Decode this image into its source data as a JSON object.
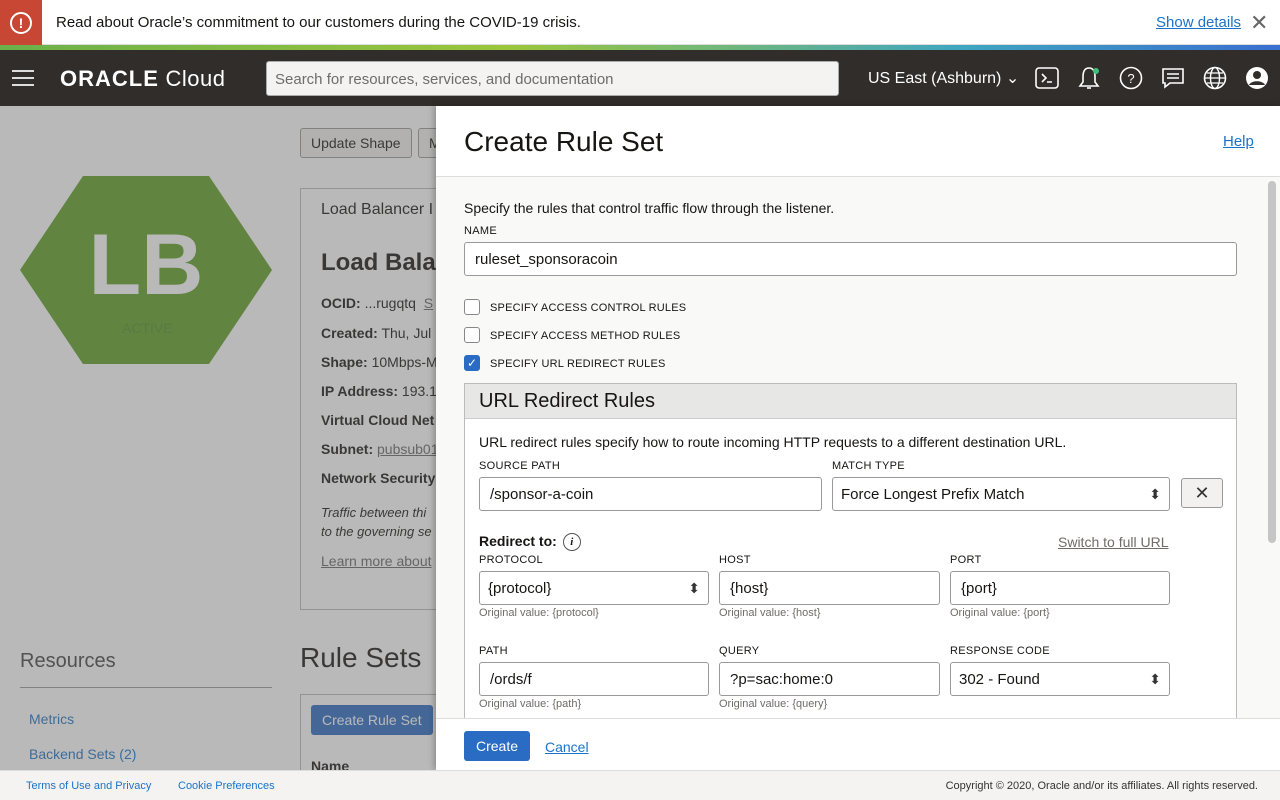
{
  "banner": {
    "message": "Read about Oracle’s commitment to our customers during the COVID-19 crisis.",
    "show_details": "Show details",
    "accent": "#c74634"
  },
  "header": {
    "logo_brand": "ORACLE",
    "logo_product": "Cloud",
    "search_placeholder": "Search for resources, services, and documentation",
    "region": "US East (Ashburn)",
    "icons": [
      "cloud-shell-icon",
      "bell-icon",
      "help-icon",
      "chat-icon",
      "globe-icon",
      "profile-icon"
    ]
  },
  "background": {
    "lb_badge": "LB",
    "lb_status": "ACTIVE",
    "update_shape": "Update Shape",
    "more_btn": "M",
    "card_title": "Load Balancer I",
    "card_heading": "Load Bala",
    "ocid_label": "OCID:",
    "ocid_value": "...rugqtq",
    "ocid_link": "S",
    "created_label": "Created:",
    "created_value": "Thu, Jul",
    "shape_label": "Shape:",
    "shape_value": "10Mbps-M",
    "ip_label": "IP Address:",
    "ip_value": "193.1",
    "vcn_label": "Virtual Cloud Net",
    "subnet_label": "Subnet:",
    "subnet_value": "pubsub01",
    "nsg_label": "Network Security",
    "traffic_line1": "Traffic between thi",
    "traffic_line2": "to the governing se",
    "learn_more": "Learn more about",
    "resources": "Resources",
    "metrics": "Metrics",
    "backend_sets": "Backend Sets (2)",
    "rule_sets": "Rule Sets",
    "create_rule_set_btn": "Create Rule Set",
    "name_col": "Name",
    "badge_color": "#5f9e25"
  },
  "panel": {
    "title": "Create Rule Set",
    "help": "Help",
    "description": "Specify the rules that control traffic flow through the listener.",
    "name_label": "NAME",
    "name_value": "ruleset_sponsoracoin",
    "checkboxes": [
      {
        "label": "SPECIFY ACCESS CONTROL RULES",
        "checked": false
      },
      {
        "label": "SPECIFY ACCESS METHOD RULES",
        "checked": false
      },
      {
        "label": "SPECIFY URL REDIRECT RULES",
        "checked": true
      }
    ],
    "redirect": {
      "title": "URL Redirect Rules",
      "description": "URL redirect rules specify how to route incoming HTTP requests to a different destination URL.",
      "source_path_label": "SOURCE PATH",
      "source_path_value": "/sponsor-a-coin",
      "match_type_label": "MATCH TYPE",
      "match_type_value": "Force Longest Prefix Match",
      "redirect_to": "Redirect to:",
      "switch_full_url": "Switch to full URL",
      "protocol_label": "PROTOCOL",
      "protocol_value": "{protocol}",
      "protocol_hint": "Original value: {protocol}",
      "host_label": "HOST",
      "host_value": "{host}",
      "host_hint": "Original value: {host}",
      "port_label": "PORT",
      "port_value": "{port}",
      "port_hint": "Original value: {port}",
      "path_label": "PATH",
      "path_value": "/ords/f",
      "path_hint": "Original value: {path}",
      "query_label": "QUERY",
      "query_value": "?p=sac:home:0",
      "query_hint": "Original value: {query}",
      "response_label": "RESPONSE CODE",
      "response_value": "302 - Found"
    },
    "create": "Create",
    "cancel": "Cancel"
  },
  "footer": {
    "terms": "Terms of Use and Privacy",
    "cookies": "Cookie Preferences",
    "copyright": "Copyright © 2020, Oracle and/or its affiliates. All rights reserved."
  }
}
